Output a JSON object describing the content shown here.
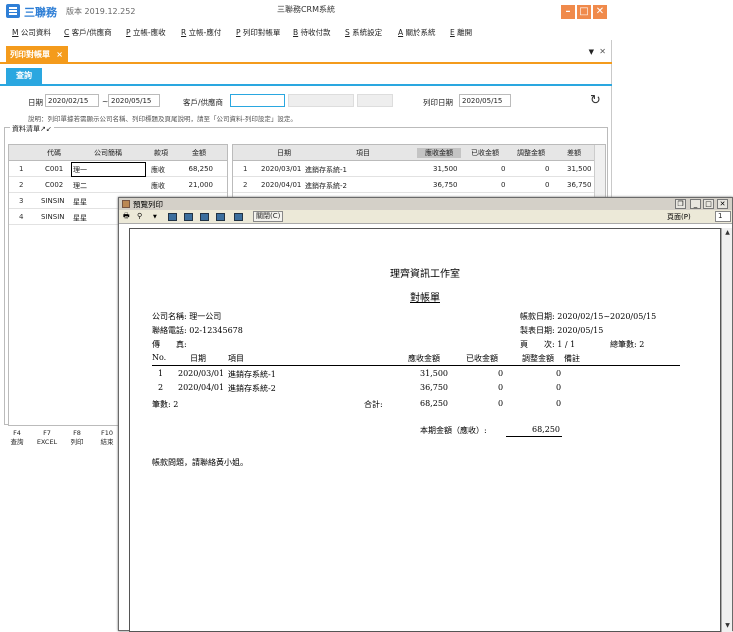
{
  "app": {
    "brand": "三聯務",
    "version": "版本 2019.12.252",
    "title": "三聯務CRM系統",
    "accent": "#f49b1c",
    "blue": "#2aa7e0"
  },
  "menu": [
    {
      "key": "M",
      "label": "公司資料"
    },
    {
      "key": "C",
      "label": "客戶/供應商"
    },
    {
      "key": "P",
      "label": "立帳-應收"
    },
    {
      "key": "R",
      "label": "立帳-應付"
    },
    {
      "key": "P",
      "label": "列印對帳單"
    },
    {
      "key": "B",
      "label": "待收付款"
    },
    {
      "key": "S",
      "label": "系統設定"
    },
    {
      "key": "A",
      "label": "關於系統"
    },
    {
      "key": "E",
      "label": "離開"
    }
  ],
  "tab": {
    "label": "列印對帳單",
    "close": "×"
  },
  "subtab": "查詢",
  "filters": {
    "date_label": "日期",
    "date_from": "2020/02/15",
    "sep": "~",
    "date_to": "2020/05/15",
    "customer_label": "客戶/供應商",
    "print_date_label": "列印日期",
    "print_date": "2020/05/15",
    "hint": "說明：列印單據若需顯示公司名稱、列印標題及頁尾說明，請至「公司資料-列印設定」設定。"
  },
  "section_label": "資料清單↗↙",
  "left_grid": {
    "headers": [
      "代碼",
      "公司簡稱",
      "款項",
      "金額"
    ],
    "rows": [
      {
        "n": "1",
        "code": "C001",
        "name": "理一",
        "type": "應收",
        "amount": "68,250"
      },
      {
        "n": "2",
        "code": "C002",
        "name": "理二",
        "type": "應收",
        "amount": "21,000"
      },
      {
        "n": "3",
        "code": "SINSIN",
        "name": "星星",
        "type": "",
        "amount": ""
      },
      {
        "n": "4",
        "code": "SINSIN",
        "name": "星星",
        "type": "",
        "amount": ""
      }
    ]
  },
  "right_grid": {
    "headers": [
      "日期",
      "項目",
      "應收金額",
      "已收金額",
      "調整金額",
      "差額"
    ],
    "rows": [
      {
        "n": "1",
        "date": "2020/03/01",
        "item": "進銷存系統-1",
        "recv": "31,500",
        "got": "0",
        "adj": "0",
        "diff": "31,500"
      },
      {
        "n": "2",
        "date": "2020/04/01",
        "item": "進銷存系統-2",
        "recv": "36,750",
        "got": "0",
        "adj": "0",
        "diff": "36,750"
      }
    ]
  },
  "fkeys": [
    {
      "key": "F4",
      "label": "查詢"
    },
    {
      "key": "F7",
      "label": "EXCEL"
    },
    {
      "key": "F8",
      "label": "列印"
    },
    {
      "key": "F10",
      "label": "結束"
    }
  ],
  "preview": {
    "title": "預覽列印",
    "close_label": "關閉(C)",
    "page_label": "頁面(P)",
    "page_value": "1",
    "report": {
      "org": "理齊資訊工作室",
      "doc_title": "對帳單",
      "company": "公司名稱: 理一公司",
      "phone": "聯絡電話: 02-12345678",
      "fax": "傳　　真:",
      "period": "帳款日期: 2020/02/15~2020/05/15",
      "made": "製表日期: 2020/05/15",
      "page": "頁　　次: 1 / 1",
      "total_count_hdr": "總筆數: 2",
      "cols": [
        "No.",
        "日期",
        "項目",
        "應收金額",
        "已收金額",
        "調整金額",
        "備註"
      ],
      "rows": [
        {
          "no": "1",
          "date": "2020/03/01",
          "item": "進銷存系統-1",
          "recv": "31,500",
          "got": "0",
          "adj": "0"
        },
        {
          "no": "2",
          "date": "2020/04/01",
          "item": "進銷存系統-2",
          "recv": "36,750",
          "got": "0",
          "adj": "0"
        }
      ],
      "count": "筆數: 2",
      "subtotal_label": "合計:",
      "subtotal_recv": "68,250",
      "subtotal_got": "0",
      "subtotal_adj": "0",
      "period_total_label": "本期金額（應收）:",
      "period_total": "68,250",
      "footer_note": "帳款問題，請聯絡黃小姐。"
    }
  }
}
